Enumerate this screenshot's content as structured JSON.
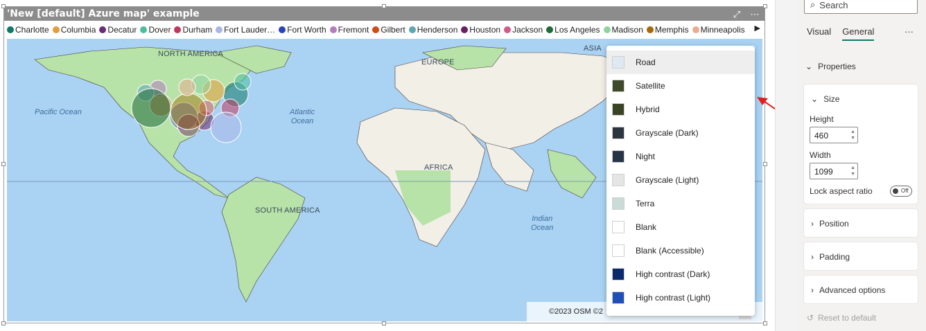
{
  "visual": {
    "title": "'New [default] Azure map' example",
    "header_icons": [
      "focus-mode-icon",
      "more-options-icon"
    ]
  },
  "legend": {
    "items": [
      {
        "label": "Charlotte",
        "color": "#117865"
      },
      {
        "label": "Columbia",
        "color": "#e59c3b"
      },
      {
        "label": "Decatur",
        "color": "#6b2c7a"
      },
      {
        "label": "Dover",
        "color": "#4dbd9e"
      },
      {
        "label": "Durham",
        "color": "#c0385e"
      },
      {
        "label": "Fort Lauder…",
        "color": "#a9b6e6"
      },
      {
        "label": "Fort Worth",
        "color": "#2c43b8"
      },
      {
        "label": "Fremont",
        "color": "#b37dbd"
      },
      {
        "label": "Gilbert",
        "color": "#d14b12"
      },
      {
        "label": "Henderson",
        "color": "#5fa6b4"
      },
      {
        "label": "Houston",
        "color": "#6a1f5e"
      },
      {
        "label": "Jackson",
        "color": "#d25a86"
      },
      {
        "label": "Los Angeles",
        "color": "#1f6a3a"
      },
      {
        "label": "Madison",
        "color": "#8fd39e"
      },
      {
        "label": "Memphis",
        "color": "#a56a05"
      },
      {
        "label": "Minneapolis",
        "color": "#e8ad91"
      }
    ],
    "more_icon": "chevron-right-icon"
  },
  "map": {
    "labels": {
      "north_america": "NORTH AMERICA",
      "europe": "EUROPE",
      "asia": "ASIA",
      "africa": "AFRICA",
      "south_america": "SOUTH AMERICA"
    },
    "oceans": {
      "pacific": "Pacific Ocean",
      "atlantic_1": "Atlantic",
      "atlantic_2": "Ocean",
      "indian_1": "Indian",
      "indian_2": "Ocean"
    },
    "copyright": "©2023 OSM ©2",
    "colors": {
      "water": "#a9d2f3",
      "land": "#f2efe7",
      "veg": "#b7e3a8",
      "border": "#4a3a3a"
    }
  },
  "style_menu": {
    "items": [
      {
        "label": "Road",
        "thumb": "#dfe9f2",
        "selected": true
      },
      {
        "label": "Satellite",
        "thumb": "#3f4a2a"
      },
      {
        "label": "Hybrid",
        "thumb": "#3a4424"
      },
      {
        "label": "Grayscale (Dark)",
        "thumb": "#2c3440"
      },
      {
        "label": "Night",
        "thumb": "#273447"
      },
      {
        "label": "Grayscale (Light)",
        "thumb": "#e5e5e5"
      },
      {
        "label": "Terra",
        "thumb": "#c9dcd8"
      },
      {
        "label": "Blank",
        "thumb": "#ffffff"
      },
      {
        "label": "Blank (Accessible)",
        "thumb": "#ffffff"
      },
      {
        "label": "High contrast (Dark)",
        "thumb": "#0b2a6b"
      },
      {
        "label": "High contrast (Light)",
        "thumb": "#1f4fb8"
      }
    ]
  },
  "pane": {
    "search_placeholder": "Search",
    "tabs": {
      "visual": "Visual",
      "general": "General"
    },
    "more": "···",
    "properties": "Properties",
    "size": {
      "title": "Size",
      "height_label": "Height",
      "height_value": "460",
      "width_label": "Width",
      "width_value": "1099",
      "lock_label": "Lock aspect ratio",
      "toggle_text": "Off"
    },
    "sections": {
      "position": "Position",
      "padding": "Padding",
      "advanced": "Advanced options"
    },
    "reset": "Reset to default"
  }
}
